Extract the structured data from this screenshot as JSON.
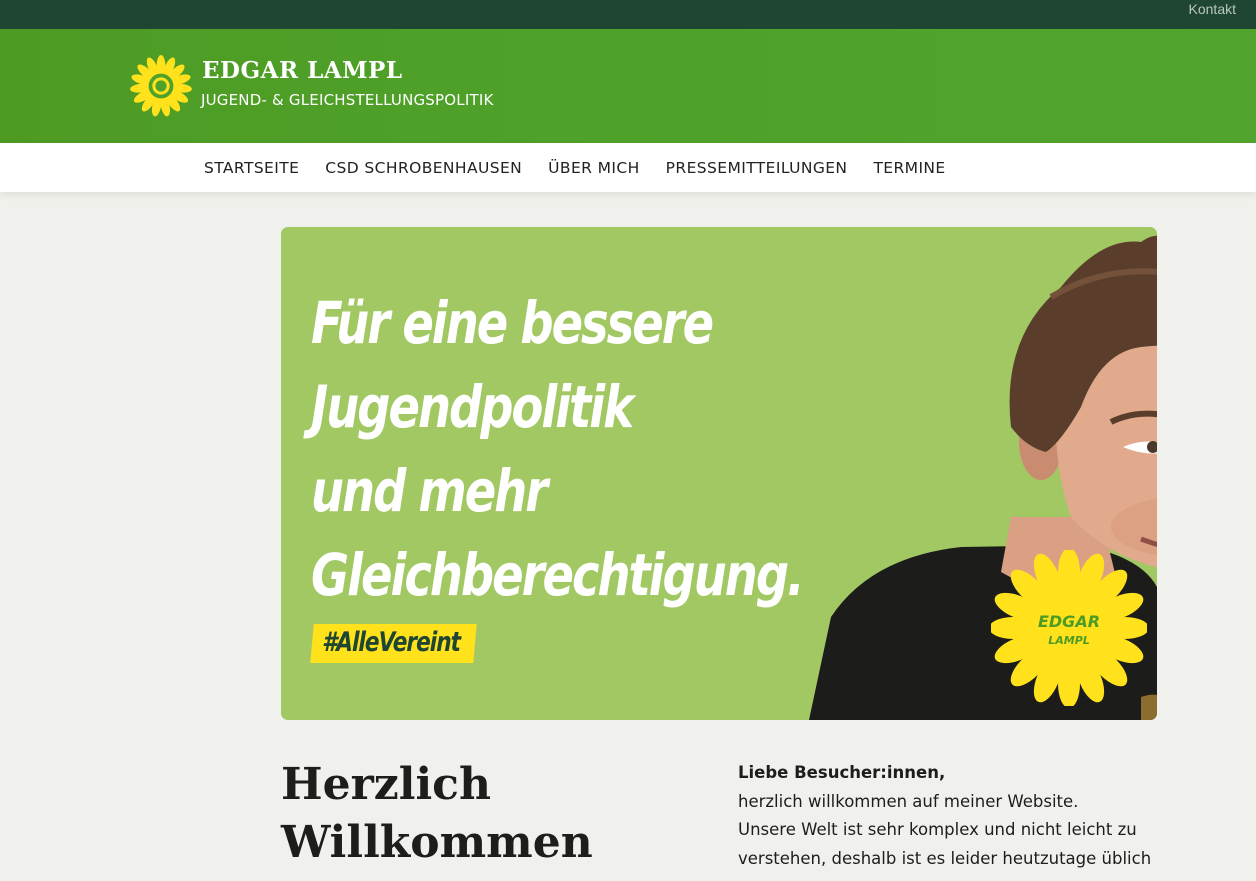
{
  "topbar": {
    "kontakt_label": "Kontakt"
  },
  "header": {
    "logo_icon": "sunflower-icon",
    "title": "EDGAR LAMPL",
    "subtitle": "JUGEND- & GLEICHSTELLUNGSPOLITIK"
  },
  "nav": {
    "items": [
      {
        "label": "STARTSEITE"
      },
      {
        "label": "CSD SCHROBENHAUSEN"
      },
      {
        "label": "ÜBER MICH"
      },
      {
        "label": "PRESSEMITTEILUNGEN"
      },
      {
        "label": "TERMINE"
      }
    ]
  },
  "hero": {
    "headline": [
      "Für eine bessere",
      "Jugendpolitik",
      "und mehr",
      "Gleichberechtigung."
    ],
    "hashtag": "#AlleVereint",
    "badge_name_1": "EDGAR",
    "badge_name_2": "LAMPL",
    "colors": {
      "background": "#a2c863",
      "hashtag_bg": "#ffe11c",
      "sunflower": "#ffe11c"
    }
  },
  "main": {
    "welcome_line_1": "Herzlich",
    "welcome_line_2": "Willkommen",
    "greeting": "Liebe Besucher:innen,",
    "paragraph_lines": [
      "herzlich willkommen auf meiner Website.",
      "Unsere Welt ist sehr komplex und nicht leicht zu",
      "verstehen, deshalb ist es leider heutzutage üblich"
    ]
  },
  "colors": {
    "topbar": "#1f4633",
    "header_green": "#4ea22a",
    "page_bg": "#f0f1ec"
  }
}
